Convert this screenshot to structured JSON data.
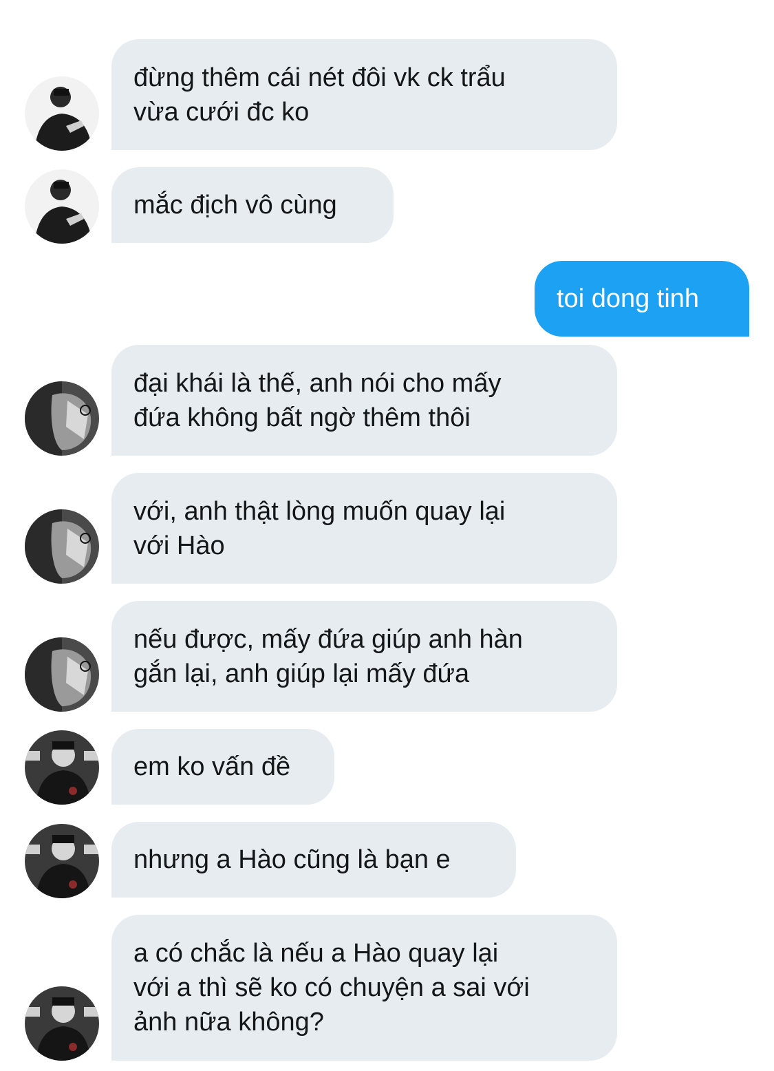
{
  "conversation": {
    "messages": [
      {
        "direction": "incoming",
        "avatar": "avatar-a",
        "lines": [
          "đừng thêm cái nét đôi vk ck trẩu",
          "vừa cưới đc ko"
        ]
      },
      {
        "direction": "incoming",
        "avatar": "avatar-a",
        "lines": [
          "mắc địch vô cùng"
        ]
      },
      {
        "direction": "outgoing",
        "lines": [
          "toi dong tinh"
        ]
      },
      {
        "direction": "incoming",
        "avatar": "avatar-b",
        "lines": [
          "đại khái là thế, anh nói cho mấy",
          "đứa không bất ngờ thêm thôi"
        ]
      },
      {
        "direction": "incoming",
        "avatar": "avatar-b",
        "lines": [
          "với, anh thật lòng muốn quay lại",
          "với Hào"
        ]
      },
      {
        "direction": "incoming",
        "avatar": "avatar-b",
        "lines": [
          "nếu được, mấy đứa giúp anh hàn",
          "gắn lại, anh giúp lại mấy đứa"
        ]
      },
      {
        "direction": "incoming",
        "avatar": "avatar-c",
        "lines": [
          "em ko vấn đề"
        ]
      },
      {
        "direction": "incoming",
        "avatar": "avatar-c",
        "lines": [
          "nhưng a Hào cũng là bạn e"
        ]
      },
      {
        "direction": "incoming",
        "avatar": "avatar-c",
        "lines": [
          "a có chắc là nếu a Hào quay lại",
          "với a thì sẽ ko có chuyện a sai với",
          "ảnh nữa không?"
        ]
      }
    ]
  },
  "colors": {
    "incoming_bubble": "#e6ecf0",
    "outgoing_bubble": "#1da1f2",
    "incoming_text": "#14171a",
    "outgoing_text": "#ffffff"
  }
}
